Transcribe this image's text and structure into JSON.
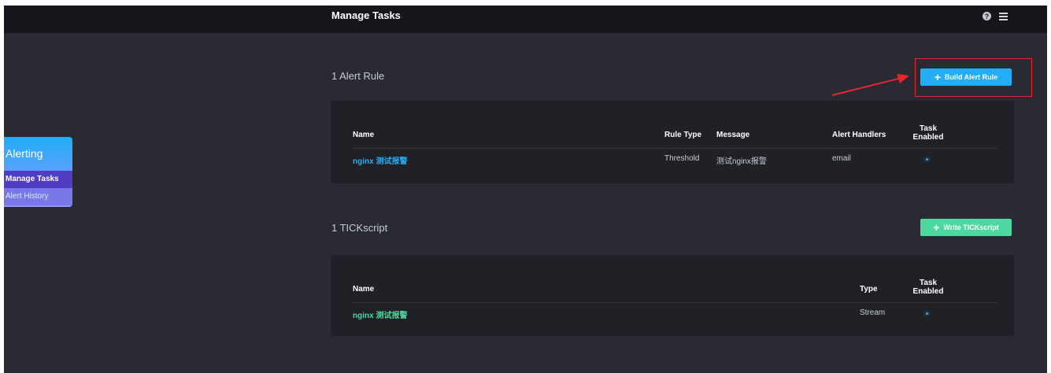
{
  "header": {
    "title": "Manage Tasks",
    "help_icon": "?",
    "icons": [
      "help-icon",
      "menu-icon"
    ]
  },
  "sidebar_menu": {
    "title": "Alerting",
    "items": [
      {
        "label": "Manage Tasks",
        "active": true
      },
      {
        "label": "Alert History",
        "active": false
      }
    ]
  },
  "alert_rules": {
    "section_title": "1 Alert Rule",
    "button_label": "Build Alert Rule",
    "columns": {
      "name": "Name",
      "rule_type": "Rule Type",
      "message": "Message",
      "handlers": "Alert Handlers",
      "enabled_line1": "Task",
      "enabled_line2": "Enabled"
    },
    "rows": [
      {
        "name": "nginx 测试报警",
        "rule_type": "Threshold",
        "message": "测试nginx报警",
        "handlers": "email",
        "enabled": true
      }
    ]
  },
  "tickscripts": {
    "section_title": "1 TICKscript",
    "button_label": "Write TICKscript",
    "columns": {
      "name": "Name",
      "type": "Type",
      "enabled_line1": "Task",
      "enabled_line2": "Enabled"
    },
    "rows": [
      {
        "name": "nginx 测试报警",
        "type": "Stream",
        "enabled": true
      }
    ]
  },
  "colors": {
    "accent_blue": "#22adf6",
    "accent_green": "#4ed8a0",
    "annotation_red": "#e8262b",
    "background": "#292a33"
  }
}
